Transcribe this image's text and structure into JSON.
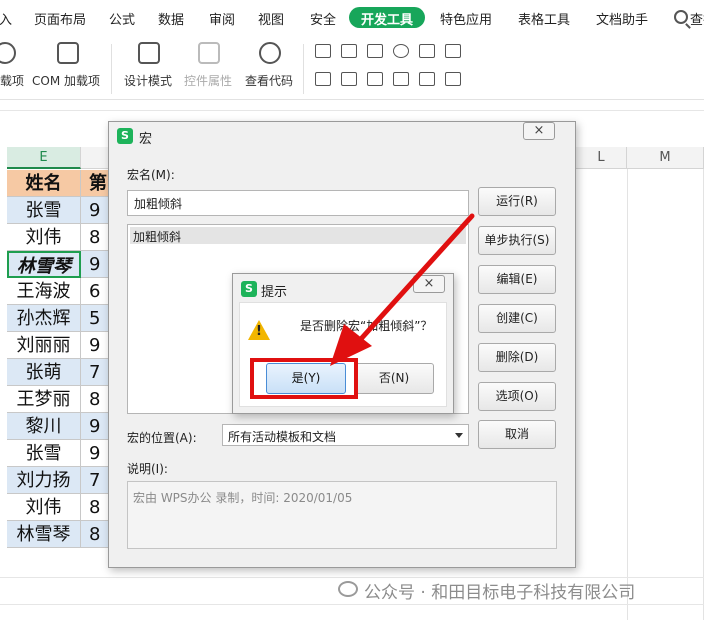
{
  "ribbon": {
    "tabs": [
      {
        "label": "插入"
      },
      {
        "label": "页面布局"
      },
      {
        "label": "公式"
      },
      {
        "label": "数据"
      },
      {
        "label": "审阅"
      },
      {
        "label": "视图"
      },
      {
        "label": "安全"
      },
      {
        "label": "开发工具",
        "active": true
      },
      {
        "label": "特色应用"
      },
      {
        "label": "表格工具"
      },
      {
        "label": "文档助手"
      },
      {
        "label": "查找"
      }
    ],
    "tools": {
      "addins": "载项",
      "com_addins": "COM 加载项",
      "design_mode": "设计模式",
      "control_properties": "控件属性",
      "view_code": "查看代码"
    },
    "accent_color": "#17a65a"
  },
  "sheet": {
    "columns": {
      "e": "E",
      "l": "L",
      "m": "M"
    },
    "header_cell": "姓名",
    "header_cell_2": "第",
    "rows": [
      {
        "name": "张雪",
        "value": "9"
      },
      {
        "name": "刘伟",
        "value": "8"
      },
      {
        "name": "林雪琴",
        "value": "9"
      },
      {
        "name": "王海波",
        "value": "6"
      },
      {
        "name": "孙杰辉",
        "value": "5"
      },
      {
        "name": "刘丽丽",
        "value": "9"
      },
      {
        "name": "张萌",
        "value": "7"
      },
      {
        "name": "王梦丽",
        "value": "8"
      },
      {
        "name": "黎川",
        "value": "9"
      },
      {
        "name": "张雪",
        "value": "9"
      },
      {
        "name": "刘力扬",
        "value": "7"
      },
      {
        "name": "刘伟",
        "value": "8"
      },
      {
        "name": "林雪琴",
        "value": "8"
      }
    ]
  },
  "macro_dialog": {
    "logo": "S",
    "title": "宏",
    "close": "×",
    "macro_name_label": "宏名(M):",
    "macro_name_value": "加粗倾斜",
    "macro_list": [
      "加粗倾斜"
    ],
    "buttons": {
      "run": "运行(R)",
      "step": "单步执行(S)",
      "edit": "编辑(E)",
      "create": "创建(C)",
      "delete": "删除(D)",
      "options": "选项(O)",
      "cancel": "取消"
    },
    "location_label": "宏的位置(A):",
    "location_value": "所有活动模板和文档",
    "description_label": "说明(I):",
    "description_value": "宏由 WPS办公 录制，时间: 2020/01/05"
  },
  "confirm_dialog": {
    "logo": "S",
    "title": "提示",
    "close": "×",
    "message": "是否删除宏“加粗倾斜”？",
    "yes": "是(Y)",
    "no": "否(N)"
  },
  "annotation_color": "#e01010",
  "watermark": "公众号 · 和田目标电子科技有限公司"
}
